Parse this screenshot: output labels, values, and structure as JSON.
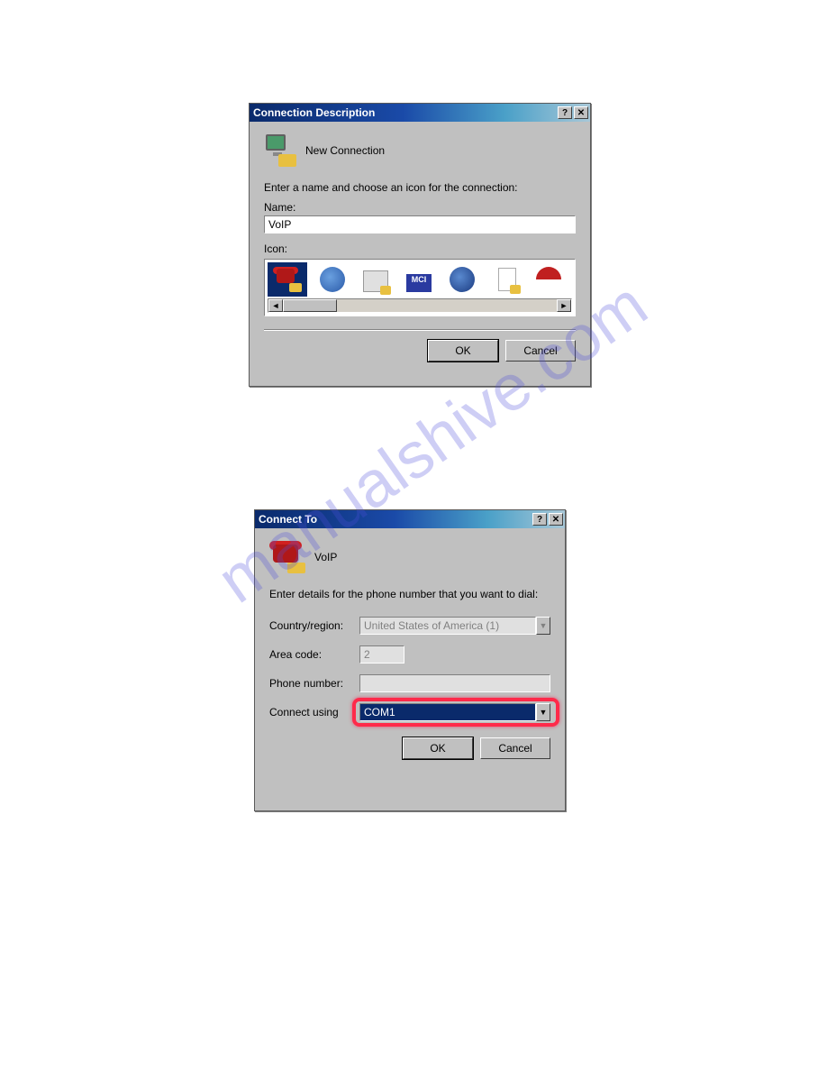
{
  "watermark": "manualshive.com",
  "dialog1": {
    "title": "Connection Description",
    "header": "New Connection",
    "instruction": "Enter a name and choose an icon for the connection:",
    "name_label": "Name:",
    "name_value": "VoIP",
    "icon_label": "Icon:",
    "icons": [
      {
        "id": "phone-red",
        "selected": true
      },
      {
        "id": "globe-lines",
        "selected": false
      },
      {
        "id": "newspaper",
        "selected": false
      },
      {
        "id": "mci",
        "selected": false
      },
      {
        "id": "earth",
        "selected": false
      },
      {
        "id": "document",
        "selected": false
      },
      {
        "id": "umbrella",
        "selected": false
      }
    ],
    "ok": "OK",
    "cancel": "Cancel"
  },
  "dialog2": {
    "title": "Connect To",
    "header": "VoIP",
    "instruction": "Enter details for the phone number that you want to dial:",
    "fields": {
      "country_label": "Country/region:",
      "country_value": "United States of America (1)",
      "area_label": "Area code:",
      "area_value": "2",
      "phone_label": "Phone number:",
      "phone_value": "",
      "connect_label": "Connect using",
      "connect_value": "COM1"
    },
    "ok": "OK",
    "cancel": "Cancel"
  }
}
